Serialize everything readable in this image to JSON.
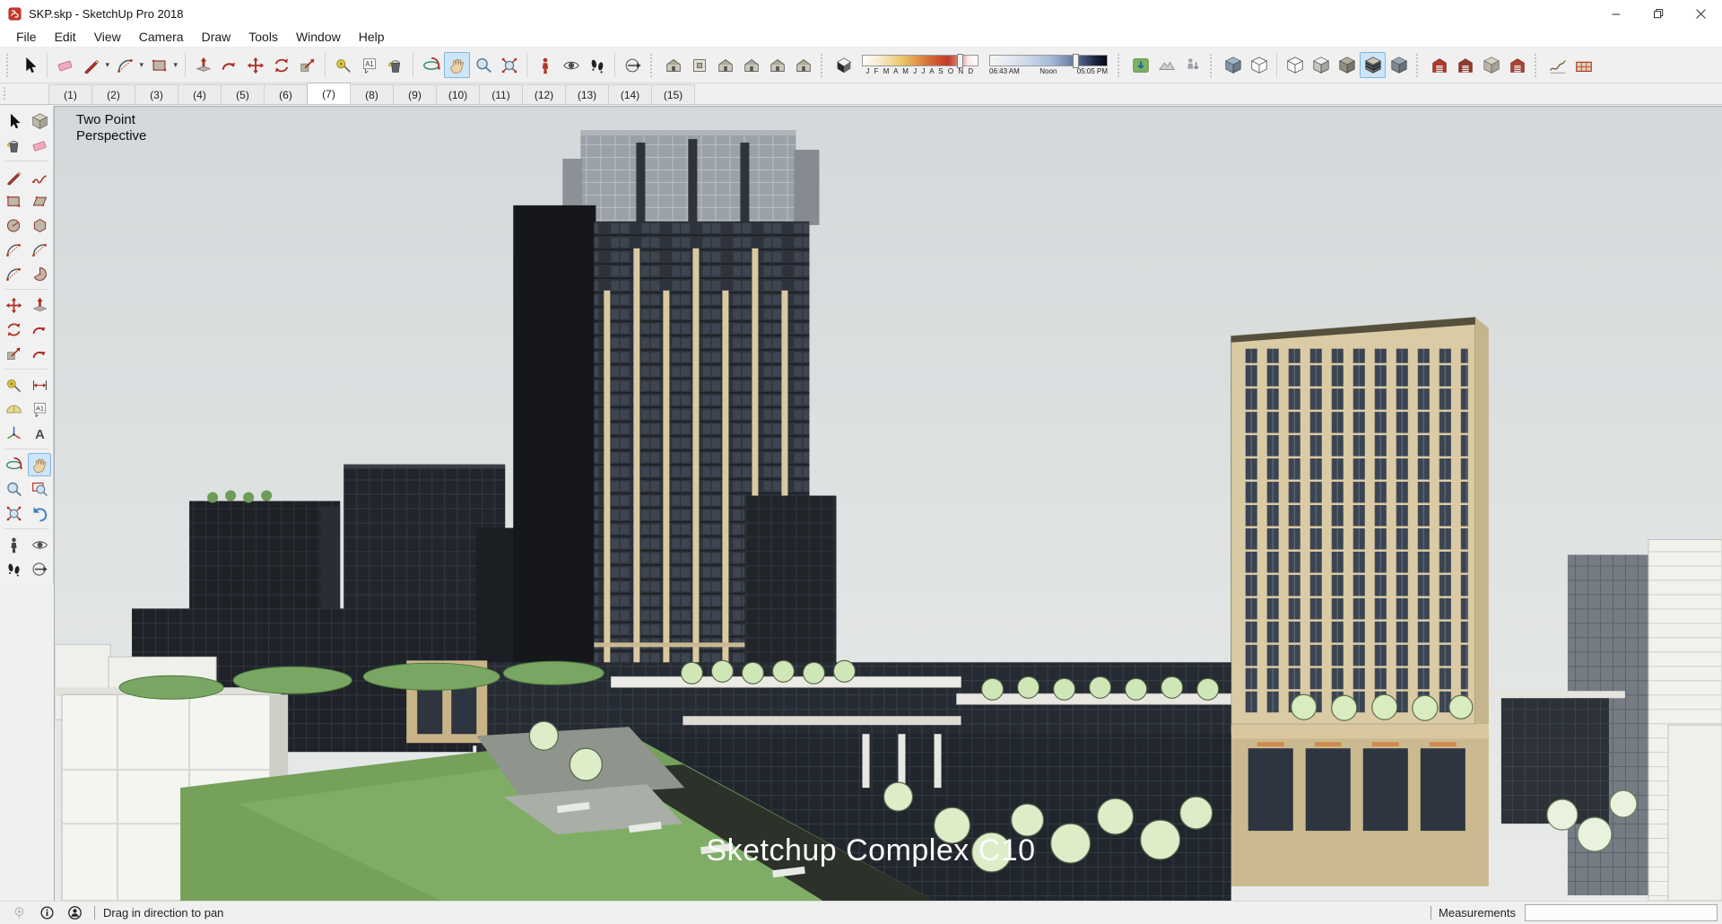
{
  "window": {
    "title": "SKP.skp - SketchUp Pro 2018",
    "controls": [
      {
        "id": "minimize-button",
        "glyph": "minimize"
      },
      {
        "id": "restore-button",
        "glyph": "restore"
      },
      {
        "id": "close-button",
        "glyph": "close"
      }
    ]
  },
  "menu_bar": {
    "items": [
      "File",
      "Edit",
      "View",
      "Camera",
      "Draw",
      "Tools",
      "Window",
      "Help"
    ]
  },
  "toolbar": {
    "groups": [
      {
        "name": "select",
        "lead": "grip",
        "items": [
          {
            "id": "select",
            "icon": "cursor"
          }
        ]
      },
      {
        "name": "draw",
        "lead": "sep",
        "items": [
          {
            "id": "eraser",
            "icon": "eraser"
          },
          {
            "id": "line",
            "icon": "pencil",
            "dropdown": true
          },
          {
            "id": "arcs",
            "icon": "arc",
            "dropdown": true
          },
          {
            "id": "shapes",
            "icon": "rect",
            "dropdown": true
          }
        ]
      },
      {
        "name": "edit",
        "lead": "sep",
        "items": [
          {
            "id": "push-pull",
            "icon": "pushpull"
          },
          {
            "id": "follow-me",
            "icon": "followme"
          },
          {
            "id": "move",
            "icon": "move"
          },
          {
            "id": "rotate",
            "icon": "rotate"
          },
          {
            "id": "scale",
            "icon": "scale"
          }
        ]
      },
      {
        "name": "construction",
        "lead": "sep",
        "items": [
          {
            "id": "tape-measure",
            "icon": "tape"
          },
          {
            "id": "text",
            "icon": "textA"
          },
          {
            "id": "paint-bucket",
            "icon": "paint"
          }
        ]
      },
      {
        "name": "camera",
        "lead": "sep",
        "items": [
          {
            "id": "orbit",
            "icon": "orbit"
          },
          {
            "id": "pan",
            "icon": "hand",
            "active": true
          },
          {
            "id": "zoom",
            "icon": "zoom"
          },
          {
            "id": "zoom-extents",
            "icon": "zoomext"
          }
        ]
      },
      {
        "name": "walkthrough",
        "lead": "sep",
        "items": [
          {
            "id": "position-camera",
            "icon": "person",
            "color": "#b3362a"
          },
          {
            "id": "look-around",
            "icon": "eye"
          },
          {
            "id": "walk",
            "icon": "feet"
          }
        ]
      },
      {
        "name": "section",
        "lead": "sep",
        "items": [
          {
            "id": "section-plane",
            "icon": "section"
          }
        ]
      },
      {
        "name": "views",
        "lead": "grip",
        "items": [
          {
            "id": "iso-view",
            "icon": "house"
          },
          {
            "id": "top-view",
            "icon": "boxtop"
          },
          {
            "id": "front-view",
            "icon": "house"
          },
          {
            "id": "right-view",
            "icon": "house"
          },
          {
            "id": "back-view",
            "icon": "house"
          },
          {
            "id": "left-view",
            "icon": "house"
          }
        ]
      },
      {
        "name": "shadows",
        "lead": "grip",
        "items": [
          {
            "id": "shadows-toggle",
            "icon": "shadowbox"
          },
          {
            "type": "date-slider",
            "id": "shadow-date-slider"
          },
          {
            "type": "time-slider",
            "id": "shadow-time-slider"
          }
        ]
      },
      {
        "name": "location",
        "lead": "grip",
        "items": [
          {
            "id": "add-location",
            "icon": "addloc"
          },
          {
            "id": "toggle-terrain",
            "icon": "terrain"
          },
          {
            "id": "photo-textures",
            "icon": "phototex"
          }
        ]
      },
      {
        "name": "face-style-a",
        "lead": "grip",
        "items": [
          {
            "id": "x-ray",
            "icon": "cube",
            "color": "#9fb6cc"
          },
          {
            "id": "back-edges",
            "icon": "cubewire"
          }
        ]
      },
      {
        "name": "face-style-b",
        "lead": "sep",
        "items": [
          {
            "id": "wireframe",
            "icon": "cubewire"
          },
          {
            "id": "hidden-line",
            "icon": "cube",
            "color": "#f2f2ee"
          },
          {
            "id": "shaded",
            "icon": "cube",
            "color": "#b4ad9c"
          },
          {
            "id": "shaded-with-textures",
            "icon": "cubetex",
            "active": true
          },
          {
            "id": "monochrome",
            "icon": "cube",
            "color": "#9aa7b5"
          }
        ]
      },
      {
        "name": "warehouse",
        "lead": "grip",
        "items": [
          {
            "id": "3d-warehouse",
            "icon": "warehouse",
            "color": "#b3362a"
          },
          {
            "id": "share-model",
            "icon": "warehouse",
            "color": "#8f3a2e"
          },
          {
            "id": "share-component",
            "icon": "component"
          },
          {
            "id": "extension-warehouse",
            "icon": "warehouse",
            "color": "#a84434"
          }
        ]
      },
      {
        "name": "sandbox",
        "lead": "grip",
        "items": [
          {
            "id": "from-contours",
            "icon": "contours"
          },
          {
            "id": "from-scratch",
            "icon": "scratch"
          }
        ]
      }
    ],
    "shadows": {
      "months_label": "J F M A M J J A S O N D",
      "time_labels": [
        "06:43 AM",
        "Noon",
        "05:05 PM"
      ],
      "date_thumb_pct": 84,
      "time_thumb_pct": 73
    }
  },
  "scene_tabs": {
    "tabs": [
      "(1)",
      "(2)",
      "(3)",
      "(4)",
      "(5)",
      "(6)",
      "(7)",
      "(8)",
      "(9)",
      "(10)",
      "(11)",
      "(12)",
      "(13)",
      "(14)",
      "(15)"
    ],
    "active_index": 6
  },
  "tool_palette": {
    "groups": [
      {
        "rows": [
          [
            {
              "id": "select",
              "icon": "cursor"
            },
            {
              "id": "make-component",
              "icon": "component"
            }
          ],
          [
            {
              "id": "paint-bucket",
              "icon": "paint"
            },
            {
              "id": "eraser",
              "icon": "eraser"
            }
          ]
        ]
      },
      {
        "rows": [
          [
            {
              "id": "line",
              "icon": "pencil"
            },
            {
              "id": "freehand",
              "icon": "squiggle"
            }
          ],
          [
            {
              "id": "rectangle",
              "icon": "rect"
            },
            {
              "id": "rotated-rectangle",
              "icon": "rotrect"
            }
          ],
          [
            {
              "id": "circle",
              "icon": "circle"
            },
            {
              "id": "polygon",
              "icon": "polygon"
            }
          ],
          [
            {
              "id": "arc",
              "icon": "arc"
            },
            {
              "id": "two-point-arc",
              "icon": "arc"
            }
          ],
          [
            {
              "id": "three-point-arc",
              "icon": "arc"
            },
            {
              "id": "pie",
              "icon": "pie"
            }
          ]
        ]
      },
      {
        "rows": [
          [
            {
              "id": "move",
              "icon": "move"
            },
            {
              "id": "push-pull",
              "icon": "pushpull"
            }
          ],
          [
            {
              "id": "rotate",
              "icon": "rotate"
            },
            {
              "id": "follow-me",
              "icon": "followme"
            }
          ],
          [
            {
              "id": "scale",
              "icon": "scale"
            },
            {
              "id": "offset",
              "icon": "followme"
            }
          ]
        ]
      },
      {
        "rows": [
          [
            {
              "id": "tape-measure",
              "icon": "tape"
            },
            {
              "id": "dimension",
              "icon": "dim"
            }
          ],
          [
            {
              "id": "protractor",
              "icon": "protractor"
            },
            {
              "id": "text",
              "icon": "textA"
            }
          ],
          [
            {
              "id": "axes",
              "icon": "axes"
            },
            {
              "id": "3d-text",
              "icon": "text3d"
            }
          ]
        ]
      },
      {
        "rows": [
          [
            {
              "id": "orbit",
              "icon": "orbit"
            },
            {
              "id": "pan",
              "icon": "hand",
              "active": true
            }
          ],
          [
            {
              "id": "zoom",
              "icon": "zoom"
            },
            {
              "id": "zoom-window",
              "icon": "zoomwin"
            }
          ],
          [
            {
              "id": "zoom-extents",
              "icon": "zoomext"
            },
            {
              "id": "previous",
              "icon": "prev"
            }
          ]
        ]
      },
      {
        "rows": [
          [
            {
              "id": "position-camera",
              "icon": "person",
              "color": "#444444"
            },
            {
              "id": "look-around",
              "icon": "eye"
            }
          ],
          [
            {
              "id": "walk",
              "icon": "feet"
            },
            {
              "id": "section-plane",
              "icon": "section"
            }
          ]
        ]
      }
    ]
  },
  "viewport": {
    "camera_label": "Two Point Perspective",
    "watermark": "Sketchup Complex C10",
    "sky_top": "#d4d8da",
    "sky_bottom": "#e7e9e9"
  },
  "status_bar": {
    "message": "Drag in direction to pan",
    "measurements_label": "Measurements",
    "measurements_value": ""
  },
  "colors": {
    "selection_highlight": "#cde5f8",
    "tower_dark": "#2e333b",
    "tower_tan": "#dbcba5",
    "pilaster_beige": "#dbc9a2",
    "tree_pale_green": "#d9ecc0",
    "lawn_green": "#75a15b"
  }
}
